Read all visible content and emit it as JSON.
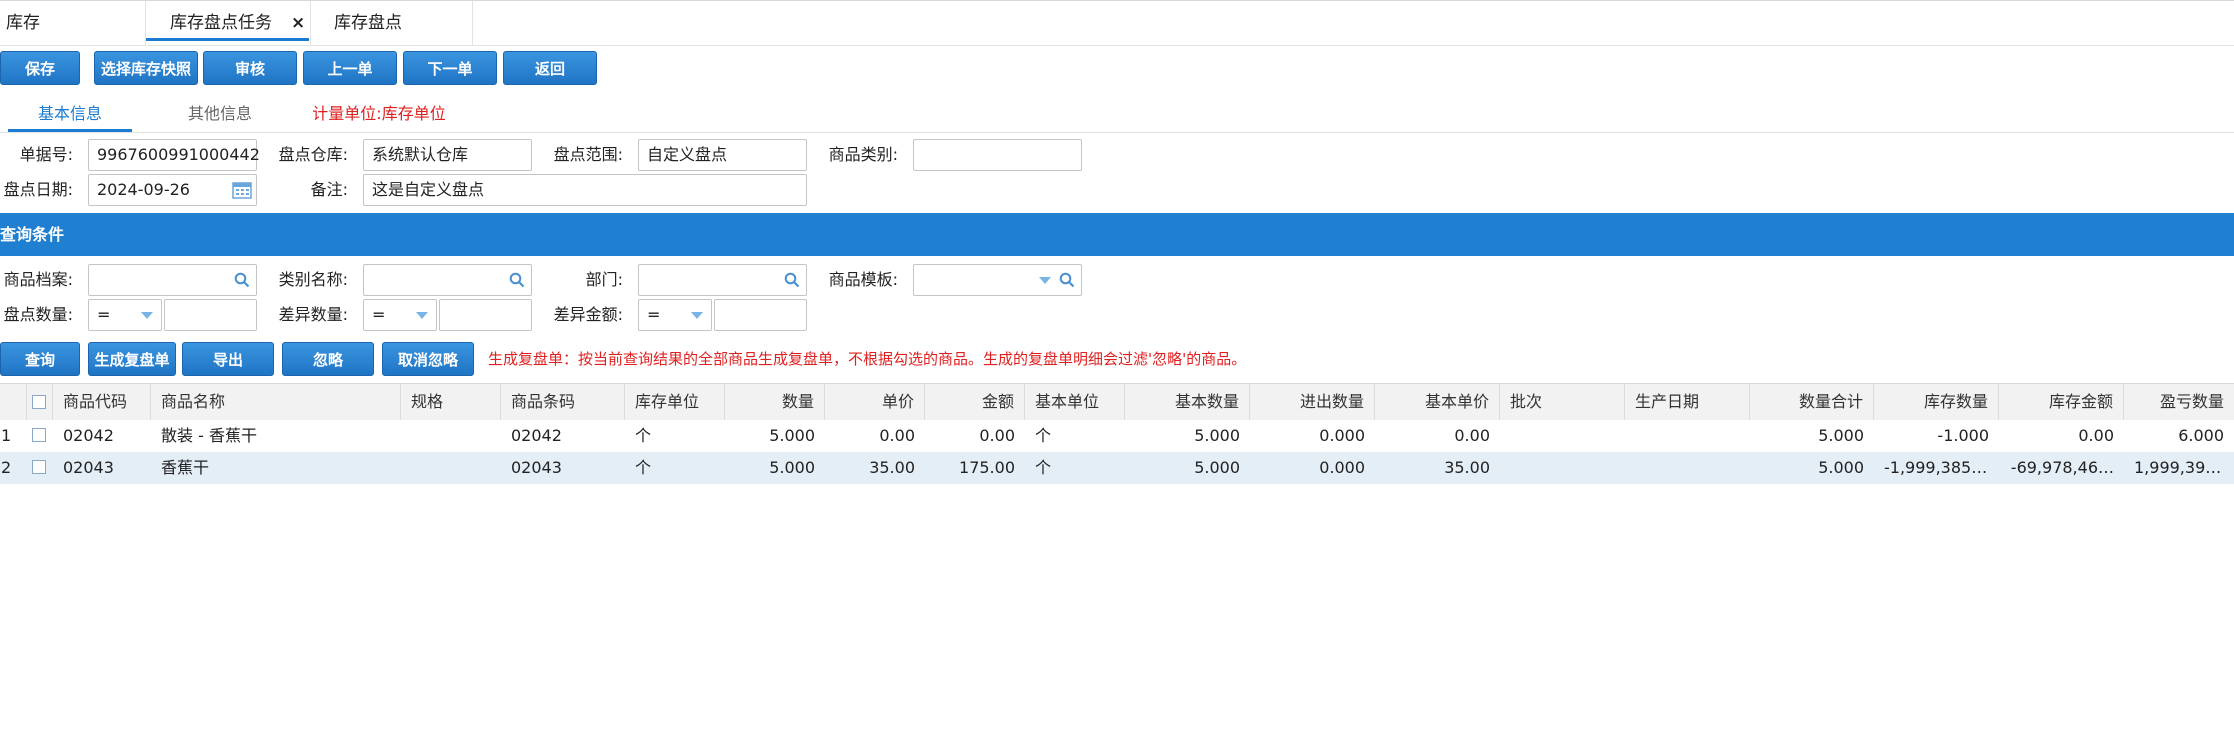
{
  "top_tabs": [
    {
      "label": "库存"
    },
    {
      "label": "库存盘点任务",
      "close": "×"
    },
    {
      "label": "库存盘点"
    }
  ],
  "toolbar": {
    "save": "保存",
    "select_snapshot": "选择库存快照",
    "audit": "审核",
    "prev": "上一单",
    "next": "下一单",
    "back": "返回"
  },
  "sub_tabs": {
    "basic": "基本信息",
    "other": "其他信息",
    "unit_note": "计量单位:库存单位"
  },
  "form": {
    "doc_no_label": "单据号:",
    "doc_no": "9967600991000442",
    "warehouse_label": "盘点仓库:",
    "warehouse": "系统默认仓库",
    "range_label": "盘点范围:",
    "range": "自定义盘点",
    "category_label": "商品类别:",
    "category": "",
    "date_label": "盘点日期:",
    "date": "2024-09-26",
    "remark_label": "备注:",
    "remark": "这是自定义盘点"
  },
  "query_bar": {
    "title": "查询条件"
  },
  "query": {
    "product_label": "商品档案:",
    "category_name_label": "类别名称:",
    "dept_label": "部门:",
    "template_label": "商品模板:",
    "count_qty_label": "盘点数量:",
    "diff_qty_label": "差异数量:",
    "diff_amt_label": "差异金额:",
    "op1": "=",
    "op2": "=",
    "op3": "="
  },
  "actions": {
    "query": "查询",
    "gen_recheck": "生成复盘单",
    "export": "导出",
    "ignore": "忽略",
    "cancel_ignore": "取消忽略",
    "hint": "生成复盘单：按当前查询结果的全部商品生成复盘单，不根据勾选的商品。生成的复盘单明细会过滤'忽略'的商品。"
  },
  "grid": {
    "headers": [
      "商品代码",
      "商品名称",
      "规格",
      "商品条码",
      "库存单位",
      "数量",
      "单价",
      "金额",
      "基本单位",
      "基本数量",
      "进出数量",
      "基本单价",
      "批次",
      "生产日期",
      "数量合计",
      "库存数量",
      "库存金额",
      "盈亏数量"
    ],
    "rows": [
      {
        "idx": "1",
        "code": "02042",
        "name": "散装 - 香蕉干",
        "spec": "",
        "barcode": "02042",
        "unit": "个",
        "qty": "5.000",
        "price": "0.00",
        "amount": "0.00",
        "base_unit": "个",
        "base_qty": "5.000",
        "io_qty": "0.000",
        "base_price": "0.00",
        "batch": "",
        "prod_date": "",
        "qty_total": "5.000",
        "stock_qty": "-1.000",
        "stock_amt": "0.00",
        "pl_qty": "6.000"
      },
      {
        "idx": "2",
        "code": "02043",
        "name": "香蕉干",
        "spec": "",
        "barcode": "02043",
        "unit": "个",
        "qty": "5.000",
        "price": "35.00",
        "amount": "175.00",
        "base_unit": "个",
        "base_qty": "5.000",
        "io_qty": "0.000",
        "base_price": "35.00",
        "batch": "",
        "prod_date": "",
        "qty_total": "5.000",
        "stock_qty": "-1,999,385.…",
        "stock_amt": "-69,978,46…",
        "pl_qty": "1,999,390.…"
      }
    ]
  }
}
